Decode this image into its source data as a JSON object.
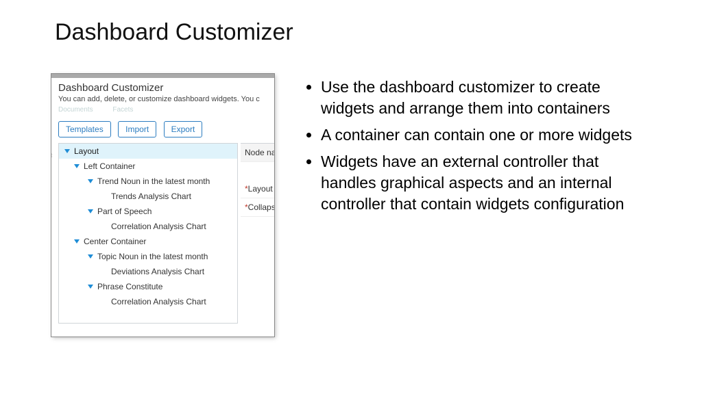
{
  "slide": {
    "title": "Dashboard Customizer",
    "bullets": [
      "Use the dashboard customizer to create widgets and arrange them into containers",
      "A container can contain one or more widgets",
      "Widgets have an external controller that handles graphical aspects and an internal controller that contain widgets configuration"
    ]
  },
  "panel": {
    "title": "Dashboard Customizer",
    "subtitle": "You can add, delete, or customize dashboard widgets. You c",
    "ghost_tabs": {
      "documents": "Documents",
      "facets": "Facets"
    },
    "buttons": {
      "templates": "Templates",
      "import": "Import",
      "export": "Export"
    },
    "tree": {
      "root": "Layout",
      "left_container": "Left Container",
      "left_w1": "Trend Noun in the latest month",
      "left_w1_chart": "Trends Analysis Chart",
      "left_w2": "Part of Speech",
      "left_w2_chart": "Correlation Analysis Chart",
      "center_container": "Center Container",
      "center_w1": "Topic Noun in the latest month",
      "center_w1_chart": "Deviations Analysis Chart",
      "center_w2": "Phrase Constitute",
      "center_w2_chart": "Correlation Analysis Chart"
    },
    "right": {
      "node": "Node na",
      "layout": "Layout",
      "collapse": "Collaps"
    },
    "left_ghost": {
      "a": "nt",
      "b": ""
    }
  }
}
